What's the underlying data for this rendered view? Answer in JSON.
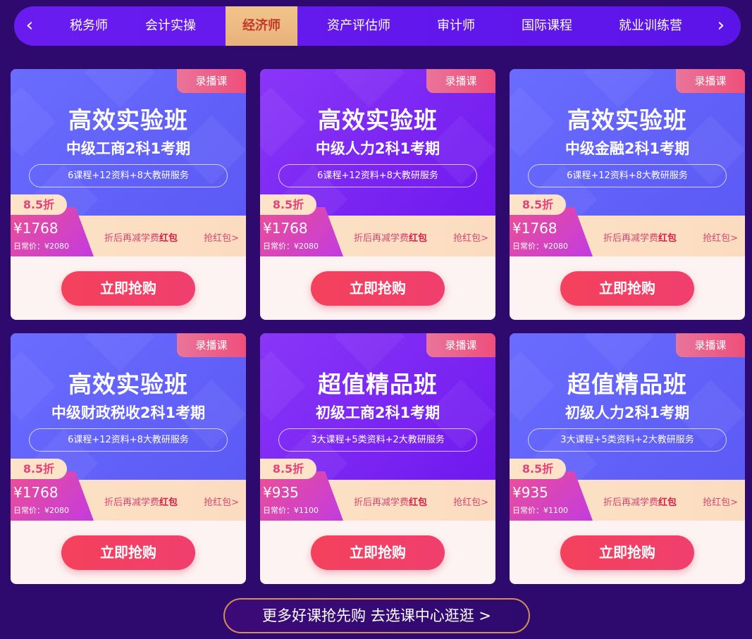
{
  "nav": {
    "prev_icon": "chevron-left-icon",
    "next_icon": "chevron-right-icon",
    "prev_glyph": "‹",
    "next_glyph": "›",
    "tabs": [
      {
        "label": "税务师"
      },
      {
        "label": "会计实操"
      },
      {
        "label": "经济师",
        "active": true
      },
      {
        "label": "资产评估师"
      },
      {
        "label": "审计师"
      },
      {
        "label": "国际课程"
      },
      {
        "label": "就业训练营"
      }
    ]
  },
  "cards": [
    {
      "tag": "录播课",
      "title": "高效实验班",
      "subtitle": "中级工商2科1考期",
      "features": "6课程+12资料+8大教研服务",
      "discount": "8.5折",
      "price": "¥1768",
      "original": "日常价：¥2080",
      "promo_prefix": "折后再减学费",
      "promo_highlight": "红包",
      "link": "抢红包>",
      "button": "立即抢购",
      "theme": "blue"
    },
    {
      "tag": "录播课",
      "title": "高效实验班",
      "subtitle": "中级人力2科1考期",
      "features": "6课程+12资料+8大教研服务",
      "discount": "8.5折",
      "price": "¥1768",
      "original": "日常价：¥2080",
      "promo_prefix": "折后再减学费",
      "promo_highlight": "红包",
      "link": "抢红包>",
      "button": "立即抢购",
      "theme": "purple"
    },
    {
      "tag": "录播课",
      "title": "高效实验班",
      "subtitle": "中级金融2科1考期",
      "features": "6课程+12资料+8大教研服务",
      "discount": "8.5折",
      "price": "¥1768",
      "original": "日常价：¥2080",
      "promo_prefix": "折后再减学费",
      "promo_highlight": "红包",
      "link": "抢红包>",
      "button": "立即抢购",
      "theme": "blue"
    },
    {
      "tag": "录播课",
      "title": "高效实验班",
      "subtitle": "中级财政税收2科1考期",
      "features": "6课程+12资料+8大教研服务",
      "discount": "8.5折",
      "price": "¥1768",
      "original": "日常价：¥2080",
      "promo_prefix": "折后再减学费",
      "promo_highlight": "红包",
      "link": "抢红包>",
      "button": "立即抢购",
      "theme": "blue"
    },
    {
      "tag": "录播课",
      "title": "超值精品班",
      "subtitle": "初级工商2科1考期",
      "features": "3大课程+5类资料+2大教研服务",
      "discount": "8.5折",
      "price": "¥935",
      "original": "日常价：¥1100",
      "promo_prefix": "折后再减学费",
      "promo_highlight": "红包",
      "link": "抢红包>",
      "button": "立即抢购",
      "theme": "purple"
    },
    {
      "tag": "录播课",
      "title": "超值精品班",
      "subtitle": "初级人力2科1考期",
      "features": "3大课程+5类资料+2大教研服务",
      "discount": "8.5折",
      "price": "¥935",
      "original": "日常价：¥1100",
      "promo_prefix": "折后再减学费",
      "promo_highlight": "红包",
      "link": "抢红包>",
      "button": "立即抢购",
      "theme": "blue"
    }
  ],
  "more_button": "更多好课抢先购 去选课中心逛逛 >",
  "colors": {
    "page_bg": "#2e0a6e",
    "nav_bg": "#6a1cf0",
    "active_tab": "#e9b880",
    "card_blue": "#5f60fa",
    "card_purple": "#7d26f3",
    "buy_button": "#f24163"
  }
}
